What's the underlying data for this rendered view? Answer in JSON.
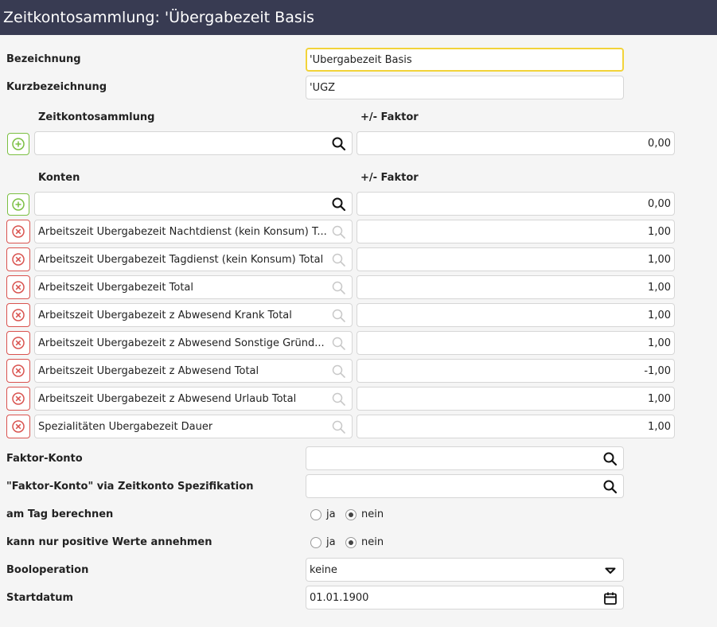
{
  "header": {
    "title": "Zeitkontosammlung: 'Übergabezeit Basis"
  },
  "form": {
    "bezeichnung": {
      "label": "Bezeichnung",
      "value": "'Übergabezeit Basis"
    },
    "kurzbezeichnung": {
      "label": "Kurzbezeichnung",
      "value": "'ÜGZ"
    }
  },
  "zeitkontosammlung": {
    "col_label": "Zeitkontosammlung",
    "factor_label": "+/- Faktor",
    "new_row": {
      "value": "",
      "factor": "0,00"
    }
  },
  "konten": {
    "col_label": "Konten",
    "factor_label": "+/- Faktor",
    "new_row": {
      "value": "",
      "factor": "0,00"
    },
    "rows": [
      {
        "name": "Arbeitszeit Übergabezeit Nachtdienst (kein Konsum) T...",
        "factor": "1,00"
      },
      {
        "name": "Arbeitszeit Übergabezeit Tagdienst (kein Konsum) Total",
        "factor": "1,00"
      },
      {
        "name": "Arbeitszeit Übergabezeit Total",
        "factor": "1,00"
      },
      {
        "name": "Arbeitszeit Übergabezeit z Abwesend Krank Total",
        "factor": "1,00"
      },
      {
        "name": "Arbeitszeit Übergabezeit z Abwesend Sonstige Gründ...",
        "factor": "1,00"
      },
      {
        "name": "Arbeitszeit Übergabezeit z Abwesend Total",
        "factor": "-1,00"
      },
      {
        "name": "Arbeitszeit Übergabezeit z Abwesend Urlaub Total",
        "factor": "1,00"
      },
      {
        "name": "Spezialitäten Übergabezeit Dauer",
        "factor": "1,00"
      }
    ]
  },
  "faktor_konto": {
    "label": "Faktor-Konto",
    "value": ""
  },
  "faktor_konto_spec": {
    "label": "\"Faktor-Konto\" via Zeitkonto Spezifikation",
    "value": ""
  },
  "am_tag": {
    "label": "am Tag berechnen",
    "opt_ja": "ja",
    "opt_nein": "nein",
    "selected": "nein"
  },
  "positive": {
    "label": "kann nur positive Werte annehmen",
    "opt_ja": "ja",
    "opt_nein": "nein",
    "selected": "nein"
  },
  "booloperation": {
    "label": "Booloperation",
    "value": "keine"
  },
  "startdatum": {
    "label": "Startdatum",
    "value": "01.01.1900"
  },
  "colors": {
    "header_bg": "#383b52",
    "add": "#7bbf42",
    "delete": "#d9534f",
    "focus": "#f2d33a"
  },
  "icons": {
    "search": "search-icon",
    "add": "plus-circle-icon",
    "delete": "x-circle-icon",
    "dropdown": "caret-down-icon",
    "calendar": "calendar-icon"
  }
}
